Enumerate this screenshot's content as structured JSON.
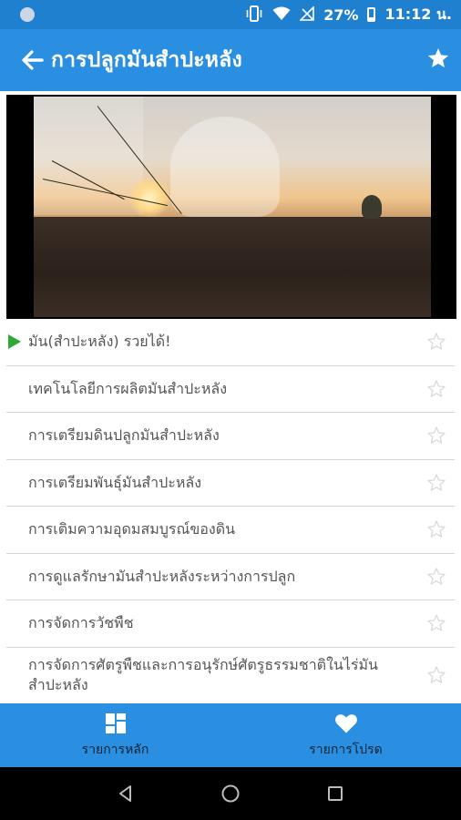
{
  "status_bar": {
    "battery": "27%",
    "time": "11:12 น."
  },
  "app_bar": {
    "title": "การปลูกมันสำปะหลัง"
  },
  "video": {
    "icon": "video-thumbnail"
  },
  "list": {
    "items": [
      {
        "label": "มัน(สำปะหลัง) รวยได้!",
        "playing": true
      },
      {
        "label": "เทคโนโลยีการผลิตมันสำปะหลัง",
        "playing": false
      },
      {
        "label": "การเตรียมดินปลูกมันสำปะหลัง",
        "playing": false
      },
      {
        "label": "การเตรียมพันธุ์มันสำปะหลัง",
        "playing": false
      },
      {
        "label": "การเติมความอุดมสมบูรณ์ของดิน",
        "playing": false
      },
      {
        "label": "การดูแลรักษามันสำปะหลังระหว่างการปลูก",
        "playing": false
      },
      {
        "label": "การจัดการวัชพืช",
        "playing": false
      },
      {
        "label": "การจัดการศัตรูพืชและการอนุรักษ์ศัตรูธรรมชาติในไร่มันสำปะหลัง",
        "playing": false
      }
    ]
  },
  "bottom_nav": {
    "main_label": "รายการหลัก",
    "favorites_label": "รายการโปรด"
  },
  "colors": {
    "primary": "#2a8fe0",
    "status": "#1f80cf",
    "play": "#2ea836"
  }
}
